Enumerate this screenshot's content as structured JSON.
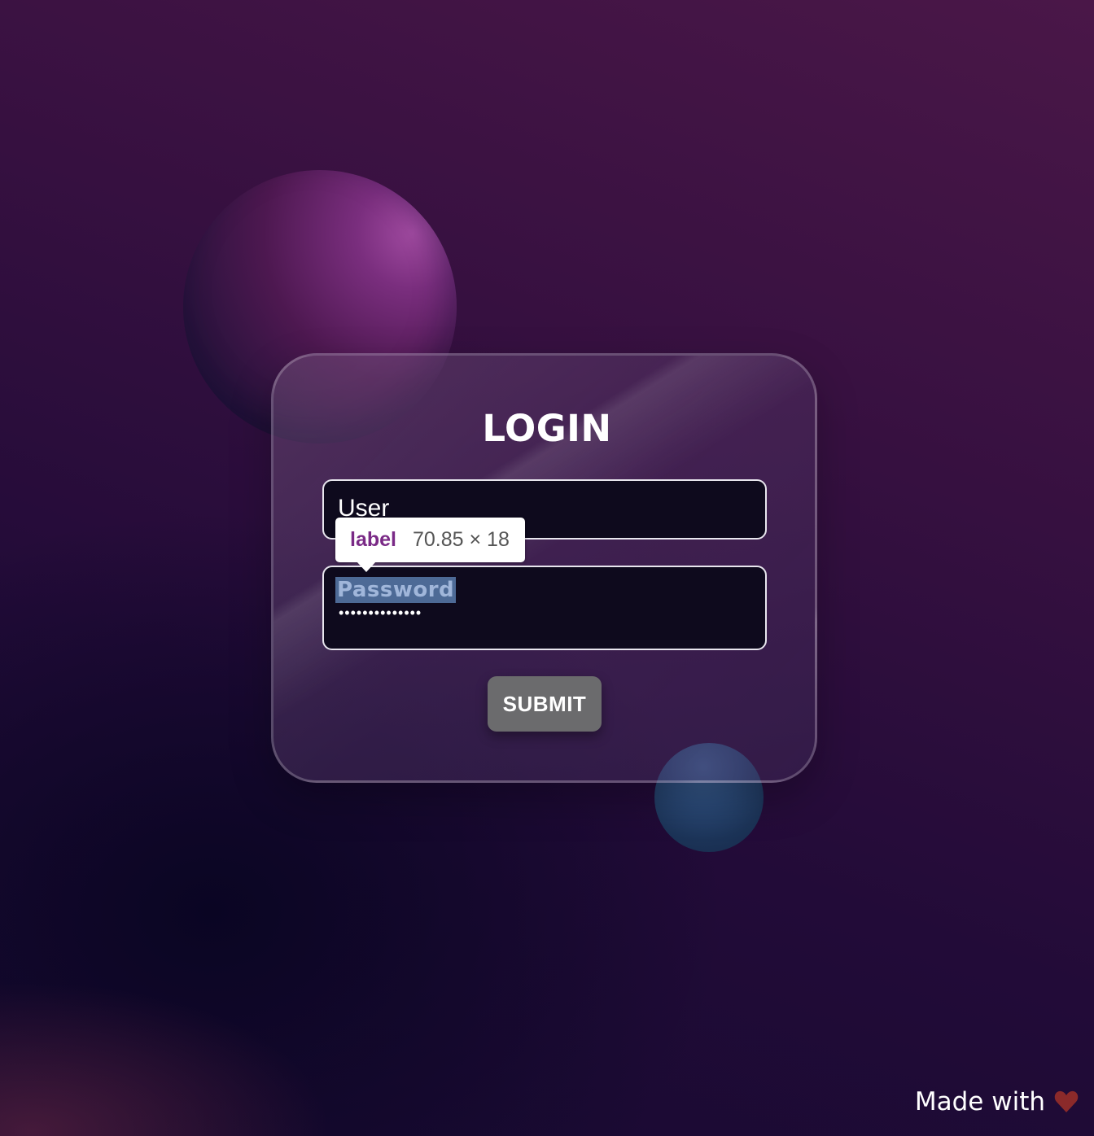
{
  "form": {
    "title": "LOGIN",
    "user_label": "User",
    "password_label": "Password",
    "password_value": "••••••••••••••",
    "submit_label": "SUBMIT"
  },
  "devtools_tooltip": {
    "tag": "label",
    "size": "70.85 × 18"
  },
  "footer": {
    "text": "Made with",
    "icon": "heart-icon",
    "icon_color": "#8b2a2a"
  },
  "colors": {
    "background": "#2a0d3c",
    "card_border": "rgba(255,255,255,0.22)",
    "button": "#6b6b6d",
    "selection_highlight": "#4d6a96"
  }
}
